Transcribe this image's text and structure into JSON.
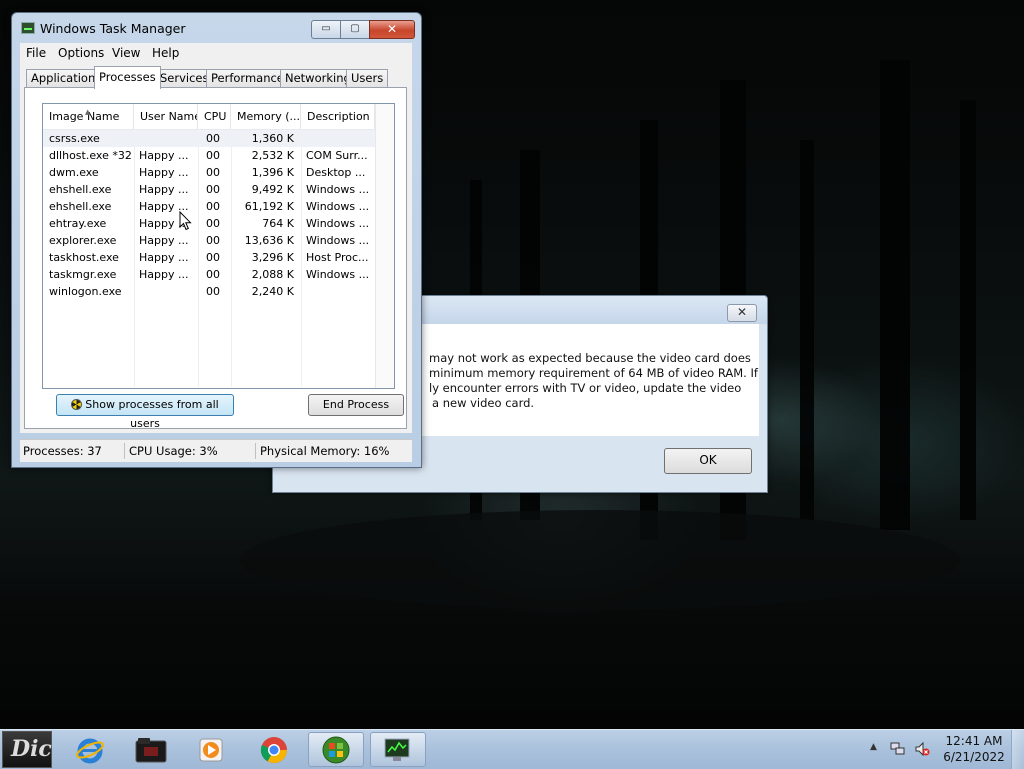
{
  "task_manager": {
    "title": "Windows Task Manager",
    "window_buttons": {
      "minimize": "▭",
      "maximize": "▢",
      "close": "✕"
    },
    "menu": [
      "File",
      "Options",
      "View",
      "Help"
    ],
    "tabs": [
      "Applications",
      "Processes",
      "Services",
      "Performance",
      "Networking",
      "Users"
    ],
    "active_tab": "Processes",
    "columns": [
      "Image Name",
      "User Name",
      "CPU",
      "Memory (...",
      "Description"
    ],
    "rows": [
      {
        "image": "csrss.exe",
        "user": "",
        "cpu": "00",
        "memory": "1,360 K",
        "description": ""
      },
      {
        "image": "dllhost.exe *32",
        "user": "Happy ...",
        "cpu": "00",
        "memory": "2,532 K",
        "description": "COM Surr..."
      },
      {
        "image": "dwm.exe",
        "user": "Happy ...",
        "cpu": "00",
        "memory": "1,396 K",
        "description": "Desktop ..."
      },
      {
        "image": "ehshell.exe",
        "user": "Happy ...",
        "cpu": "00",
        "memory": "9,492 K",
        "description": "Windows ..."
      },
      {
        "image": "ehshell.exe",
        "user": "Happy ...",
        "cpu": "00",
        "memory": "61,192 K",
        "description": "Windows ..."
      },
      {
        "image": "ehtray.exe",
        "user": "Happy ...",
        "cpu": "00",
        "memory": "764 K",
        "description": "Windows ..."
      },
      {
        "image": "explorer.exe",
        "user": "Happy ...",
        "cpu": "00",
        "memory": "13,636 K",
        "description": "Windows ..."
      },
      {
        "image": "taskhost.exe",
        "user": "Happy ...",
        "cpu": "00",
        "memory": "3,296 K",
        "description": "Host Proc..."
      },
      {
        "image": "taskmgr.exe",
        "user": "Happy ...",
        "cpu": "00",
        "memory": "2,088 K",
        "description": "Windows ..."
      },
      {
        "image": "winlogon.exe",
        "user": "",
        "cpu": "00",
        "memory": "2,240 K",
        "description": ""
      }
    ],
    "show_all_button": "Show processes from all users",
    "end_process_button": "End Process",
    "status": {
      "processes": "Processes: 37",
      "cpu": "CPU Usage: 3%",
      "memory": "Physical Memory: 16%"
    }
  },
  "dialog": {
    "close_label": "✕",
    "message_lines": [
      "may not work as expected because the video card does",
      "minimum memory requirement of 64 MB of video RAM. If",
      "ly encounter errors with TV or video, update the video",
      "a new video card."
    ],
    "ok_label": "OK"
  },
  "taskbar": {
    "start_label": "Dic",
    "clock_time": "12:41 AM",
    "clock_date": "6/21/2022"
  }
}
